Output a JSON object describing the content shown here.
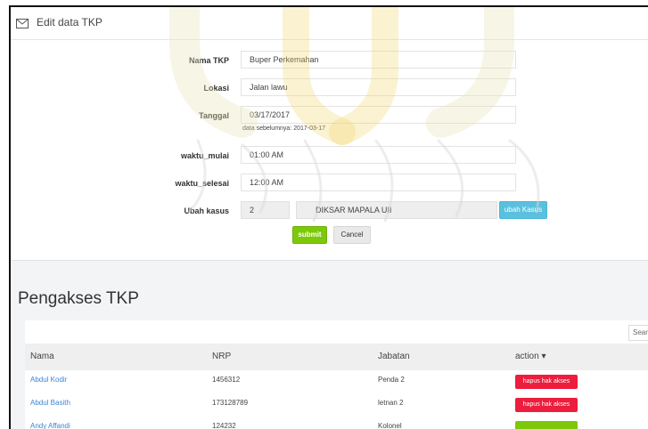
{
  "panel": {
    "title": "Edit data TKP",
    "icon": "envelope-icon"
  },
  "form": {
    "fields": [
      {
        "label": "Nama TKP",
        "value": "Buper Perkemahan"
      },
      {
        "label": "Lokasi",
        "value": "Jalan lawu"
      },
      {
        "label": "Tanggal",
        "value": "03/17/2017",
        "hint": "data sebelumnya: 2017-03-17"
      },
      {
        "label": "waktu_mulai",
        "value": "01:00 AM"
      },
      {
        "label": "waktu_selesai",
        "value": "12:00 AM"
      }
    ],
    "ubah_kasus": {
      "label": "Ubah kasus",
      "id_value": "2",
      "name_value": "DIKSAR MAPALA UII",
      "button": "ubah Kasus"
    },
    "submit": "submit",
    "cancel": "Cancel"
  },
  "access": {
    "title": "Pengakses TKP",
    "search_placeholder": "Search",
    "columns": [
      "Nama",
      "NRP",
      "Jabatan",
      "action ▾"
    ],
    "rows": [
      {
        "nama": "Abdul Kodir",
        "nrp": "1456312",
        "jabatan": "Penda 2",
        "action": "hapus hak akses",
        "action_color": "#ec1d3d"
      },
      {
        "nama": "Abdul Basith",
        "nrp": "173128789",
        "jabatan": "letnan 2",
        "action": "hapus hak akses",
        "action_color": "#ec1d3d"
      },
      {
        "nama": "Andy Affandi",
        "nrp": "124232",
        "jabatan": "Kolonel",
        "action": "",
        "action_color": "#7ec80a"
      }
    ]
  },
  "colors": {
    "accent_green": "#7ec80a",
    "danger_red": "#ec1d3d",
    "info_blue": "#5bc0de",
    "link_blue": "#3a86d6"
  }
}
